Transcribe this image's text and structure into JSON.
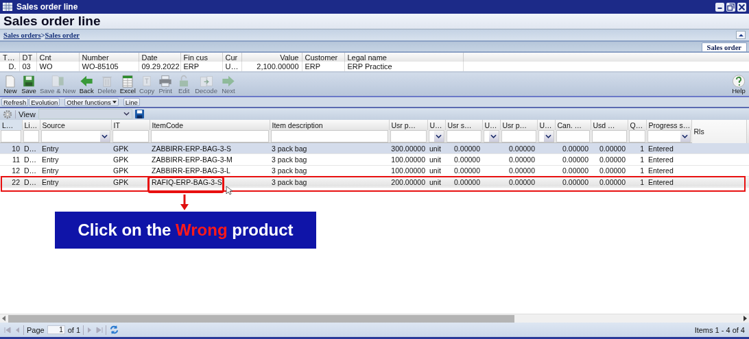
{
  "window": {
    "title": "Sales order line"
  },
  "heading": "Sales order line",
  "breadcrumb": [
    {
      "label": "Sales orders"
    },
    {
      "label": ">",
      "kind": "separator"
    },
    {
      "label": "Sales order"
    }
  ],
  "side_tab": {
    "label": "Sales order",
    "selected": true
  },
  "header_table": {
    "columns": [
      "T…",
      "DT",
      "Cnt",
      "Number",
      "Date",
      "Fin cus",
      "Cur",
      "Value",
      "Customer",
      "Legal name"
    ],
    "row": [
      "D.",
      "03",
      "WO",
      "WO-85105",
      "09.29.2022",
      "ERP",
      "U…",
      "2,100.00000",
      "ERP",
      "ERP Practice"
    ]
  },
  "toolbar": [
    {
      "label": "New",
      "disabled": false
    },
    {
      "label": "Save",
      "disabled": false
    },
    {
      "label": "Save & New",
      "disabled": true
    },
    {
      "label": "Back",
      "disabled": false
    },
    {
      "label": "Delete",
      "disabled": true
    },
    {
      "label": "Excel",
      "disabled": false
    },
    {
      "label": "Copy",
      "disabled": true
    },
    {
      "label": "Print",
      "disabled": true
    },
    {
      "label": "Edit",
      "disabled": true
    },
    {
      "label": "Decode",
      "disabled": true
    },
    {
      "label": "Next",
      "disabled": true
    }
  ],
  "help": {
    "label": "Help"
  },
  "function_buttons": [
    {
      "label": "Refresh",
      "kind": "button"
    },
    {
      "label": "Evolution",
      "kind": "button"
    },
    {
      "label": "Other functions",
      "kind": "menu"
    },
    {
      "label": "Line",
      "kind": "button"
    }
  ],
  "view_bar": {
    "label": "View"
  },
  "grid": {
    "columns": [
      {
        "label": "L…",
        "kind": "number"
      },
      {
        "label": "Li…",
        "kind": "text"
      },
      {
        "label": "Source",
        "kind": "choice"
      },
      {
        "label": "IT",
        "kind": "text"
      },
      {
        "label": "ItemCode",
        "kind": "text"
      },
      {
        "label": "Item description",
        "kind": "text"
      },
      {
        "label": "Usr p…",
        "kind": "number"
      },
      {
        "label": "U…",
        "kind": "choice"
      },
      {
        "label": "Usr s…",
        "kind": "number"
      },
      {
        "label": "U…",
        "kind": "choice"
      },
      {
        "label": "Usr p…",
        "kind": "number"
      },
      {
        "label": "U…",
        "kind": "choice"
      },
      {
        "label": "Can. …",
        "kind": "number"
      },
      {
        "label": "Usd …",
        "kind": "number"
      },
      {
        "label": "Q…",
        "kind": "number"
      },
      {
        "label": "Progress s…",
        "kind": "choice"
      },
      {
        "label": "Rls",
        "kind": "plain"
      }
    ],
    "rows": [
      {
        "selected": true,
        "highlighted": false,
        "cells": [
          "10",
          "D…",
          "Entry",
          "GPK",
          "ZABBIRR-ERP-BAG-3-S",
          "3 pack bag",
          "300.00000",
          "unit",
          "0.00000",
          "",
          "0.00000",
          "",
          "0.00000",
          "0.00000",
          "1",
          "Entered",
          ""
        ]
      },
      {
        "selected": false,
        "highlighted": false,
        "cells": [
          "11",
          "D…",
          "Entry",
          "GPK",
          "ZABBIRR-ERP-BAG-3-M",
          "3 pack bag",
          "100.00000",
          "unit",
          "0.00000",
          "",
          "0.00000",
          "",
          "0.00000",
          "0.00000",
          "1",
          "Entered",
          ""
        ]
      },
      {
        "selected": false,
        "highlighted": false,
        "cells": [
          "12",
          "D…",
          "Entry",
          "GPK",
          "ZABBIRR-ERP-BAG-3-L",
          "3 pack bag",
          "100.00000",
          "unit",
          "0.00000",
          "",
          "0.00000",
          "",
          "0.00000",
          "0.00000",
          "1",
          "Entered",
          ""
        ]
      },
      {
        "selected": false,
        "highlighted": true,
        "cells": [
          "22",
          "D…",
          "Entry",
          "GPK",
          "RAFIQ-ERP-BAG-3-S",
          "3 pack bag",
          "200.00000",
          "unit",
          "0.00000",
          "",
          "0.00000",
          "",
          "0.00000",
          "0.00000",
          "1",
          "Entered",
          ""
        ]
      }
    ]
  },
  "callout": {
    "parts": [
      {
        "text": "Click on the ",
        "emphasis": false
      },
      {
        "text": "Wrong",
        "emphasis": true
      },
      {
        "text": " product",
        "emphasis": false
      }
    ]
  },
  "pager": {
    "label": "Page",
    "page": "1",
    "of": "of 1",
    "items": "Items 1 - 4 of 4"
  }
}
